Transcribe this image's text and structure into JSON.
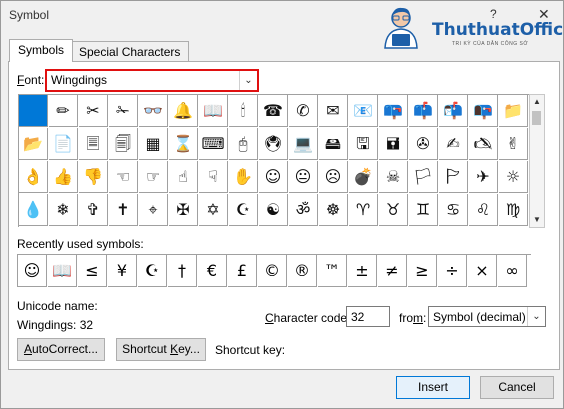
{
  "window": {
    "title": "Symbol",
    "help": "?",
    "close": "✕"
  },
  "watermark": {
    "name": "ThuthuatOffice",
    "tagline": "TRI KỲ CỦA DÂN CÔNG SỞ"
  },
  "tabs": [
    {
      "label": "Symbols",
      "active": true
    },
    {
      "label": "Special Characters",
      "active": false
    }
  ],
  "font": {
    "label_u": "F",
    "label_rest": "ont:",
    "value": "Wingdings",
    "highlight_color": "#e01010"
  },
  "symbols": [
    " ",
    "✏",
    "✂",
    "✁",
    "👓",
    "🔔",
    "📖",
    "🕯",
    "☎",
    "✆",
    "✉",
    "📧",
    "📪",
    "📫",
    "📬",
    "📭",
    "📁",
    "📂",
    "📄",
    "🗏",
    "🗐",
    "▦",
    "⌛",
    "⌨",
    "🖰",
    "🖲",
    "💻",
    "🖴",
    "🖫",
    "🖬",
    "✇",
    "✍",
    "🖎",
    "✌",
    "👌",
    "👍",
    "👎",
    "☜",
    "☞",
    "☝",
    "☟",
    "✋",
    "☺",
    "😐",
    "☹",
    "💣",
    "☠",
    "🏳",
    "🏱",
    "✈",
    "☼",
    "💧",
    "❄",
    "✞",
    "✝",
    "⌖",
    "✠",
    "✡",
    "☪",
    "☯",
    "ॐ",
    "☸",
    "♈",
    "♉",
    "♊",
    "♋",
    "♌",
    "♍"
  ],
  "recent": {
    "label": "Recently used symbols:",
    "items": [
      "☺",
      "📖",
      "≤",
      "¥",
      "☪",
      "†",
      "€",
      "£",
      "©",
      "®",
      "™",
      "±",
      "≠",
      "≥",
      "÷",
      "×",
      "∞"
    ]
  },
  "unicode_name": {
    "label": "Unicode name:",
    "value": "Wingdings: 32"
  },
  "char_code": {
    "label_pre": "",
    "label_u": "C",
    "label_rest": "haracter code:",
    "value": "32"
  },
  "from": {
    "label_pre": "fro",
    "label_u": "m",
    "label_rest": ":",
    "value": "Symbol (decimal)"
  },
  "buttons": {
    "autocorrect_u": "A",
    "autocorrect_rest": "utoCorrect...",
    "shortcut_pre": "Shortcut ",
    "shortcut_u": "K",
    "shortcut_rest": "ey...",
    "shortcut_key_label": "Shortcut key:",
    "insert": "Insert",
    "close": "Cancel"
  },
  "scroll": {
    "up": "▲",
    "down": "▼"
  },
  "dropdown_arrow": "⌄"
}
